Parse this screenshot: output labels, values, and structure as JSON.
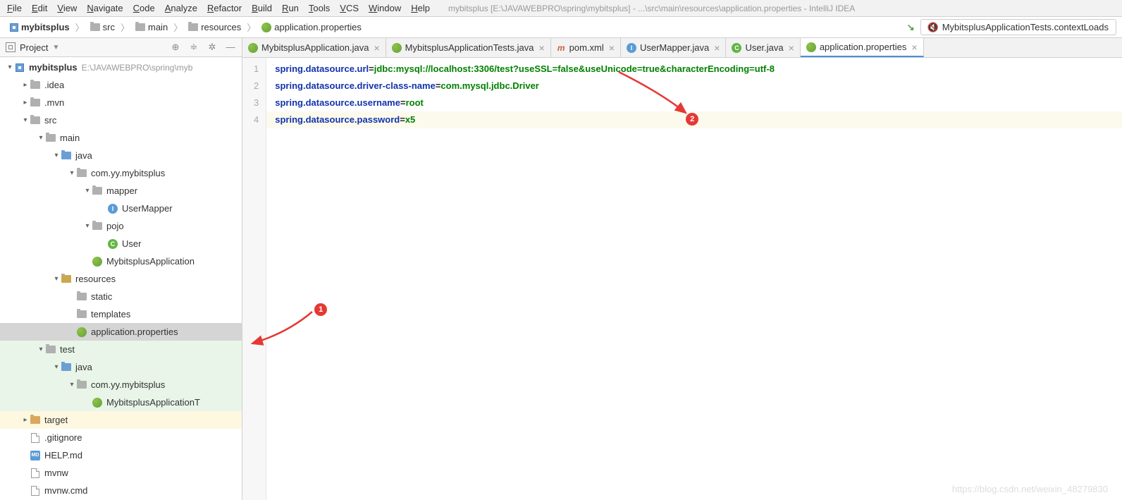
{
  "menubar": [
    "File",
    "Edit",
    "View",
    "Navigate",
    "Code",
    "Analyze",
    "Refactor",
    "Build",
    "Run",
    "Tools",
    "VCS",
    "Window",
    "Help"
  ],
  "window_title": "mybitsplus [E:\\JAVAWEBPRO\\spring\\mybitsplus] - ...\\src\\main\\resources\\application.properties - IntelliJ IDEA",
  "breadcrumb": {
    "root": "mybitsplus",
    "p1": "src",
    "p2": "main",
    "p3": "resources",
    "p4": "application.properties"
  },
  "run_config": "MybitsplusApplicationTests.contextLoads",
  "sidebar": {
    "title": "Project",
    "items": [
      {
        "depth": 0,
        "arrow": "v",
        "icon": "module",
        "label": "mybitsplus",
        "hint": "E:\\JAVAWEBPRO\\spring\\myb",
        "bold": true
      },
      {
        "depth": 1,
        "arrow": ">",
        "icon": "folder",
        "label": ".idea"
      },
      {
        "depth": 1,
        "arrow": ">",
        "icon": "folder",
        "label": ".mvn"
      },
      {
        "depth": 1,
        "arrow": "v",
        "icon": "folder",
        "label": "src"
      },
      {
        "depth": 2,
        "arrow": "v",
        "icon": "folder",
        "label": "main"
      },
      {
        "depth": 3,
        "arrow": "v",
        "icon": "folder-blue",
        "label": "java"
      },
      {
        "depth": 4,
        "arrow": "v",
        "icon": "folder",
        "label": "com.yy.mybitsplus"
      },
      {
        "depth": 5,
        "arrow": "v",
        "icon": "folder",
        "label": "mapper"
      },
      {
        "depth": 6,
        "arrow": "",
        "icon": "interface",
        "label": "UserMapper"
      },
      {
        "depth": 5,
        "arrow": "v",
        "icon": "folder",
        "label": "pojo"
      },
      {
        "depth": 6,
        "arrow": "",
        "icon": "class",
        "label": "User"
      },
      {
        "depth": 5,
        "arrow": "",
        "icon": "spring",
        "label": "MybitsplusApplication"
      },
      {
        "depth": 3,
        "arrow": "v",
        "icon": "folder-res",
        "label": "resources"
      },
      {
        "depth": 4,
        "arrow": "",
        "icon": "folder",
        "label": "static"
      },
      {
        "depth": 4,
        "arrow": "",
        "icon": "folder",
        "label": "templates"
      },
      {
        "depth": 4,
        "arrow": "",
        "icon": "spring",
        "label": "application.properties",
        "selected": true
      },
      {
        "depth": 2,
        "arrow": "v",
        "icon": "folder",
        "label": "test",
        "test": true
      },
      {
        "depth": 3,
        "arrow": "v",
        "icon": "folder-blue",
        "label": "java",
        "test": true
      },
      {
        "depth": 4,
        "arrow": "v",
        "icon": "folder",
        "label": "com.yy.mybitsplus",
        "test": true
      },
      {
        "depth": 5,
        "arrow": "",
        "icon": "spring",
        "label": "MybitsplusApplicationT",
        "test": true
      },
      {
        "depth": 1,
        "arrow": ">",
        "icon": "folder-orange",
        "label": "target",
        "excluded": true
      },
      {
        "depth": 1,
        "arrow": "",
        "icon": "file",
        "label": ".gitignore"
      },
      {
        "depth": 1,
        "arrow": "",
        "icon": "md",
        "label": "HELP.md"
      },
      {
        "depth": 1,
        "arrow": "",
        "icon": "file",
        "label": "mvnw"
      },
      {
        "depth": 1,
        "arrow": "",
        "icon": "file",
        "label": "mvnw.cmd"
      }
    ]
  },
  "tabs": [
    {
      "icon": "spring",
      "label": "MybitsplusApplication.java"
    },
    {
      "icon": "spring",
      "label": "MybitsplusApplicationTests.java"
    },
    {
      "icon": "maven",
      "label": "pom.xml"
    },
    {
      "icon": "interface",
      "label": "UserMapper.java"
    },
    {
      "icon": "class",
      "label": "User.java"
    },
    {
      "icon": "spring",
      "label": "application.properties",
      "active": true
    }
  ],
  "code": {
    "lines": [
      {
        "n": "1",
        "key": "spring.datasource.url",
        "val": "jdbc:mysql://localhost:3306/test?useSSL=false&useUnicode=true&characterEncoding=utf-8"
      },
      {
        "n": "2",
        "key": "spring.datasource.driver-class-name",
        "val": "com.mysql.jdbc.Driver"
      },
      {
        "n": "3",
        "key": "spring.datasource.username",
        "val": "root"
      },
      {
        "n": "4",
        "key": "spring.datasource.password",
        "val": "x5",
        "hl": true
      }
    ]
  },
  "annotations": {
    "b1": "1",
    "b2": "2"
  },
  "watermark": "https://blog.csdn.net/weixin_48279830"
}
